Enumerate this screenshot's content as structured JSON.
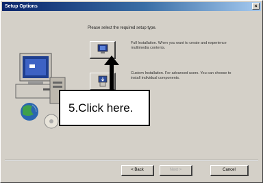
{
  "window": {
    "title": "Setup Options",
    "close_glyph": "×"
  },
  "main": {
    "prompt": "Please select the required setup type.",
    "options": [
      {
        "icon": "full-install-icon",
        "text": "Full Installation. When you want to create and experience multimedia contents."
      },
      {
        "icon": "custom-install-icon",
        "text": "Custom Installation. For advanced users. You can choose to install individual components."
      }
    ]
  },
  "footer": {
    "back_label": "< Back",
    "next_label": "Next >",
    "cancel_label": "Cancel"
  },
  "annotation": {
    "callout_text": "5.Click here."
  }
}
